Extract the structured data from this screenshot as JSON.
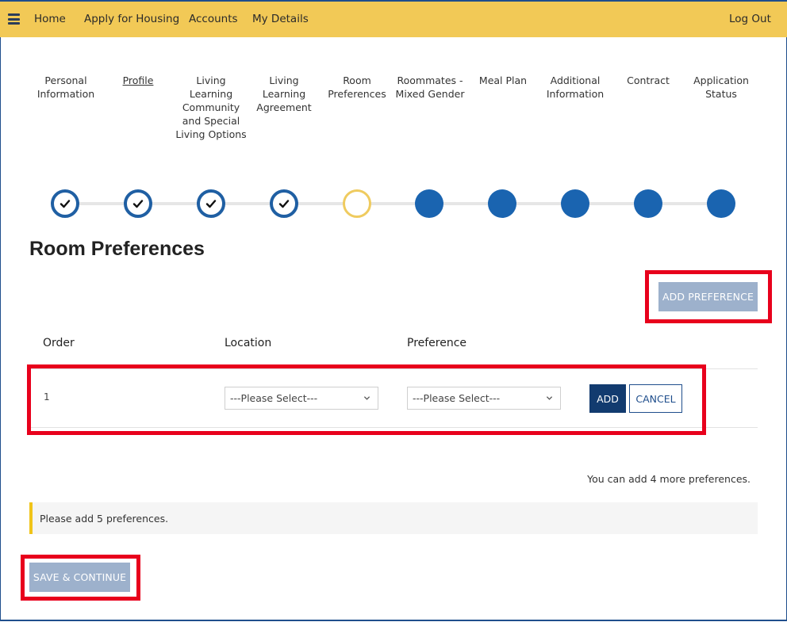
{
  "nav": {
    "menu_icon": "hamburger-menu-icon",
    "links": [
      "Home",
      "Apply for Housing",
      "Accounts",
      "My Details"
    ],
    "logout": "Log Out"
  },
  "steps": [
    {
      "label": "Personal Information",
      "status": "complete"
    },
    {
      "label": "Profile",
      "status": "complete",
      "underlined": true
    },
    {
      "label": "Living Learning Community and Special Living Options",
      "status": "complete"
    },
    {
      "label": "Living Learning Agreement",
      "status": "complete"
    },
    {
      "label": "Room Preferences",
      "status": "current"
    },
    {
      "label": "Roommates - Mixed Gender",
      "status": "pending"
    },
    {
      "label": "Meal Plan",
      "status": "pending"
    },
    {
      "label": "Additional Information",
      "status": "pending"
    },
    {
      "label": "Contract",
      "status": "pending"
    },
    {
      "label": "Application Status",
      "status": "pending"
    }
  ],
  "page_title": "Room Preferences",
  "add_preference_label": "ADD PREFERENCE",
  "table": {
    "headers": [
      "Order",
      "Location",
      "Preference"
    ],
    "row": {
      "order": "1",
      "location_value": "---Please Select---",
      "preference_value": "---Please Select---",
      "add_label": "ADD",
      "cancel_label": "CANCEL"
    }
  },
  "remaining_text": "You can add 4 more preferences.",
  "notice_text": "Please add 5 preferences.",
  "save_label": "SAVE & CONTINUE",
  "colors": {
    "topbar": "#f2c956",
    "complete": "#1f5fa3",
    "current": "#efcb5f",
    "pending": "#1a64b0",
    "highlight": "#e8001c",
    "primary_button": "#123b6f",
    "disabled_button": "#9db1cc"
  }
}
